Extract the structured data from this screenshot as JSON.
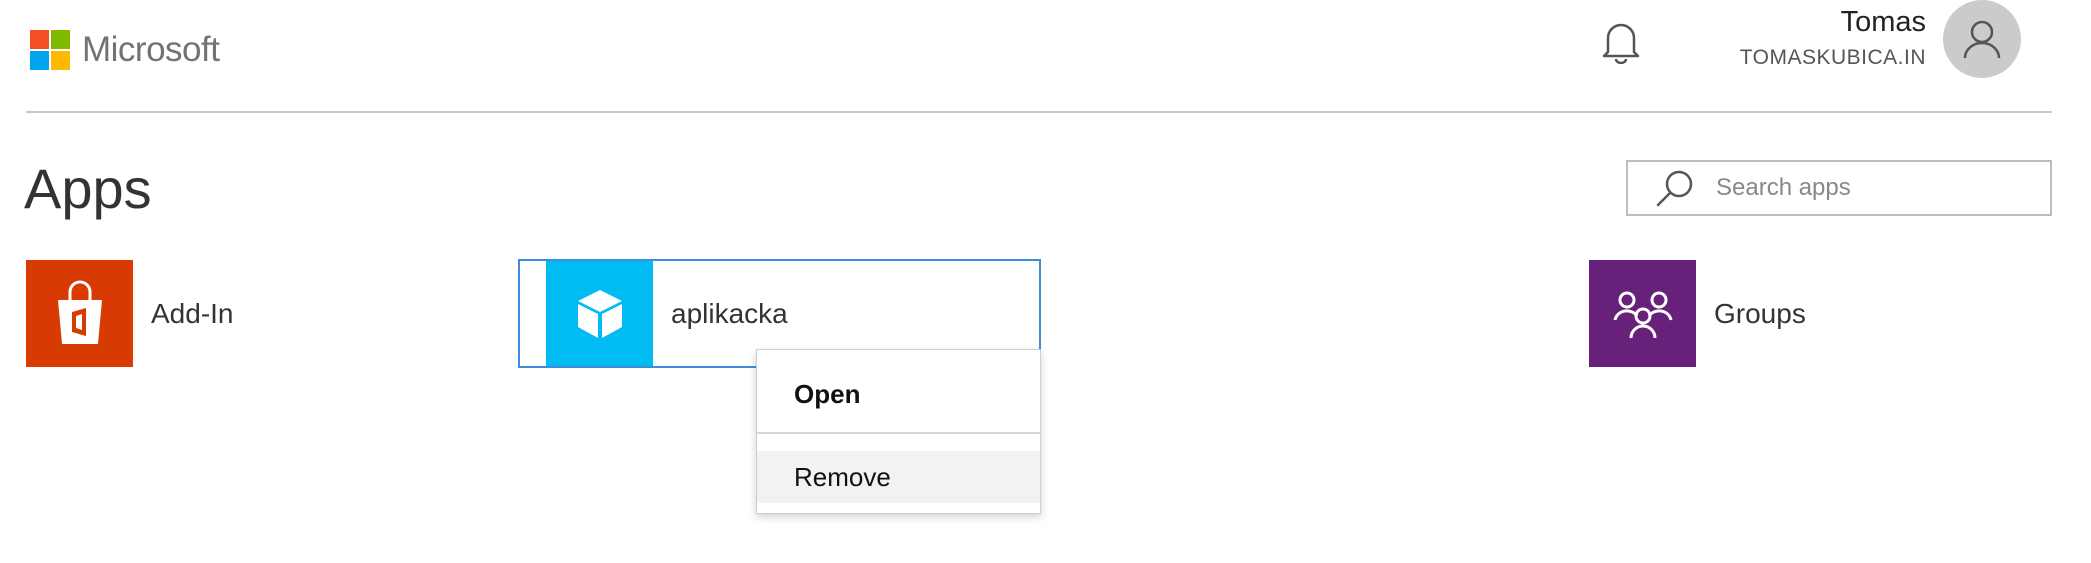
{
  "header": {
    "logo_text": "Microsoft",
    "logo_colors": [
      "#f25022",
      "#7fba00",
      "#00a4ef",
      "#ffb900"
    ],
    "user_name": "Tomas",
    "user_tenant": "TOMASKUBICA.IN",
    "icons": {
      "notifications": "bell-icon",
      "avatar": "user-avatar-icon"
    }
  },
  "page": {
    "title": "Apps"
  },
  "search": {
    "placeholder": "Search apps",
    "icon": "search-icon"
  },
  "apps": [
    {
      "label": "Add-In",
      "icon": "office-store-bag-icon",
      "color": "#d83b01"
    },
    {
      "label": "aplikacka",
      "icon": "cube-icon",
      "color": "#00bcf2",
      "selected": true
    },
    {
      "label": "Groups",
      "icon": "groups-icon",
      "color": "#68217a"
    }
  ],
  "context_menu": {
    "items": [
      {
        "label": "Open"
      },
      {
        "label": "Remove",
        "hovered": true
      }
    ]
  }
}
